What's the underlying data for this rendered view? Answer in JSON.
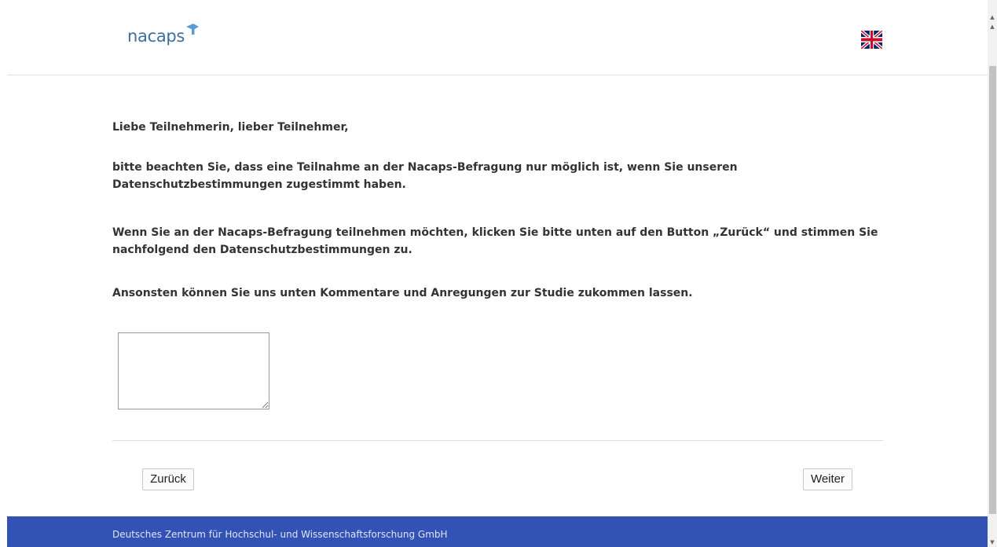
{
  "header": {
    "logo_text": "nacaps",
    "language_flag": "uk-flag-icon"
  },
  "content": {
    "greeting": "Liebe Teilnehmerin, lieber Teilnehmer,",
    "paragraph_consent": "bitte beachten Sie, dass eine Teilnahme an der Nacaps-Befragung nur möglich ist, wenn Sie unseren Datenschutzbestimmungen zugestimmt haben.",
    "paragraph_back": "Wenn Sie an der Nacaps-Befragung teilnehmen möchten, klicken Sie bitte unten auf den Button „Zurück“ und stimmen Sie nachfolgend den Datenschutzbestimmungen zu.",
    "paragraph_comments": "Ansonsten können Sie uns unten Kommentare und Anregungen zur Studie zukommen lassen."
  },
  "comment_box": {
    "value": "",
    "placeholder": ""
  },
  "navigation": {
    "back_label": "Zurück",
    "next_label": "Weiter"
  },
  "footer": {
    "text": "Deutsches Zentrum für Hochschul- und Wissenschaftsforschung GmbH"
  },
  "colors": {
    "brand_blue": "#3d6e9f",
    "logo_cap": "#5b9bd5",
    "footer_bg": "#3253b5"
  }
}
